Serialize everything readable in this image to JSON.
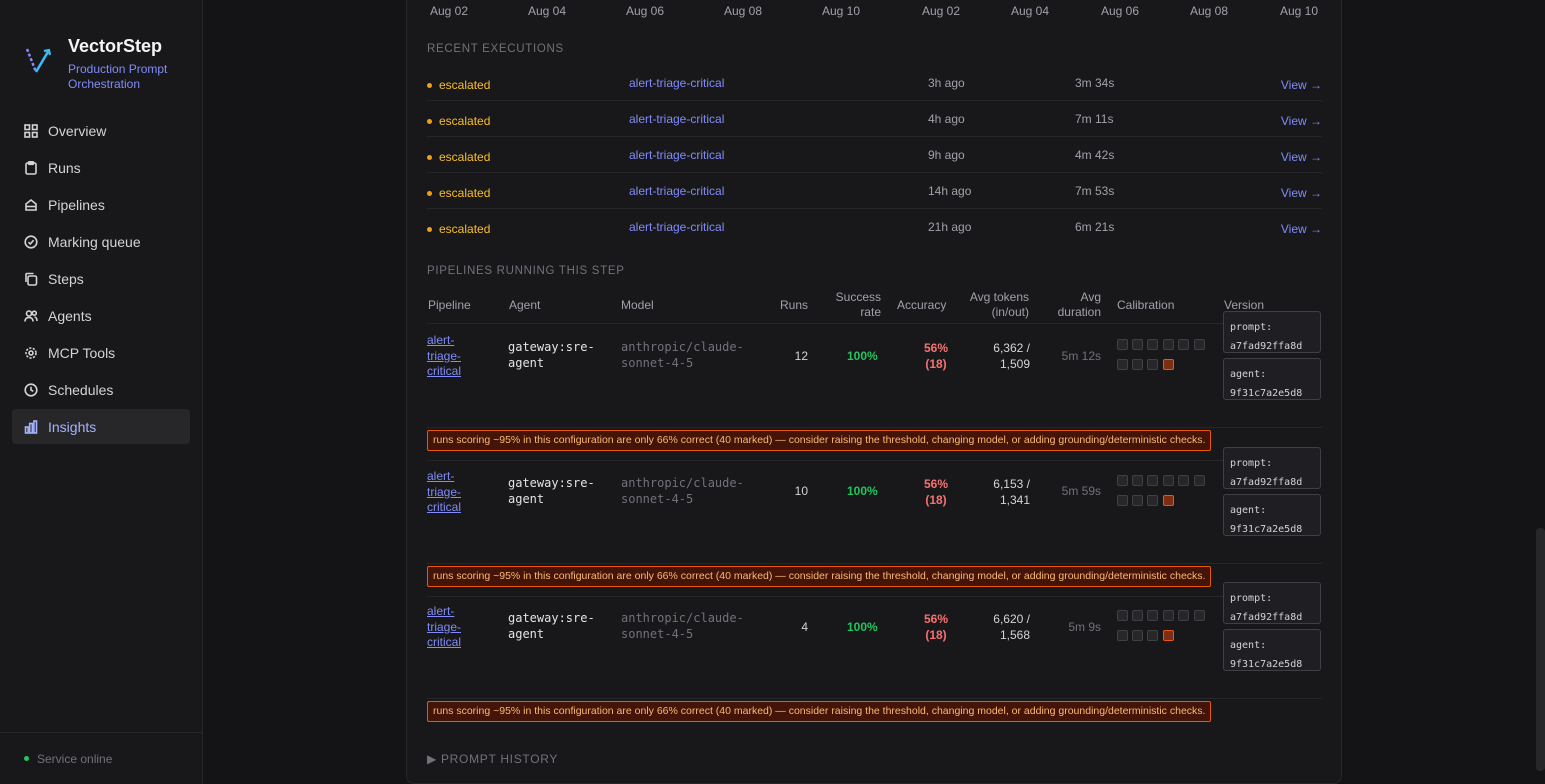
{
  "brand": {
    "name": "VectorStep",
    "subtitle": "Production Prompt Orchestration"
  },
  "nav": [
    {
      "label": "Overview",
      "icon": "grid-icon"
    },
    {
      "label": "Runs",
      "icon": "clipboard-icon"
    },
    {
      "label": "Pipelines",
      "icon": "layers-icon"
    },
    {
      "label": "Marking queue",
      "icon": "check-circle-icon"
    },
    {
      "label": "Steps",
      "icon": "copy-icon"
    },
    {
      "label": "Agents",
      "icon": "users-icon"
    },
    {
      "label": "MCP Tools",
      "icon": "gear-icon"
    },
    {
      "label": "Schedules",
      "icon": "clock-icon"
    },
    {
      "label": "Insights",
      "icon": "bar-chart-icon",
      "active": true
    }
  ],
  "footer": {
    "status": "Service online",
    "status_color": "#22c55e"
  },
  "axis_ticks": [
    "Aug 02",
    "Aug 04",
    "Aug 06",
    "Aug 08",
    "Aug 10",
    "Aug 02",
    "Aug 04",
    "Aug 06",
    "Aug 08",
    "Aug 10"
  ],
  "recent": {
    "title": "RECENT EXECUTIONS",
    "rows": [
      {
        "status": "escalated",
        "pipeline": "alert-triage-critical",
        "ago": "3h ago",
        "duration": "3m 34s",
        "action": "View →"
      },
      {
        "status": "escalated",
        "pipeline": "alert-triage-critical",
        "ago": "4h ago",
        "duration": "7m 11s",
        "action": "View →"
      },
      {
        "status": "escalated",
        "pipeline": "alert-triage-critical",
        "ago": "9h ago",
        "duration": "4m 42s",
        "action": "View →"
      },
      {
        "status": "escalated",
        "pipeline": "alert-triage-critical",
        "ago": "14h ago",
        "duration": "7m 53s",
        "action": "View →"
      },
      {
        "status": "escalated",
        "pipeline": "alert-triage-critical",
        "ago": "21h ago",
        "duration": "6m 21s",
        "action": "View →"
      }
    ]
  },
  "pipelines": {
    "title": "PIPELINES RUNNING THIS STEP",
    "headers": {
      "pipeline": "Pipeline",
      "agent": "Agent",
      "model": "Model",
      "runs": "Runs",
      "success1": "Success",
      "success2": "rate",
      "accuracy": "Accuracy",
      "tokens1": "Avg tokens",
      "tokens2": "(in/out)",
      "duration1": "Avg",
      "duration2": "duration",
      "calibration": "Calibration",
      "version": "Version"
    },
    "rows": [
      {
        "pipeline": "alert-triage-critical",
        "agent": "gateway:sre-agent",
        "model": "anthropic/claude-sonnet-4-5",
        "runs": "12",
        "success": "100%",
        "accuracy": "56% (18)",
        "tokens": "6,362 / 1,509",
        "duration": "5m 12s",
        "calibration_hot": 10,
        "version_prompt": "prompt:\na7fad92ffa8d",
        "version_agent": "agent:\n9f31c7a2e5d8",
        "warning": "runs scoring ~95% in this configuration are only 66% correct (40 marked) — consider raising the threshold, changing model, or adding grounding/deterministic checks."
      },
      {
        "pipeline": "alert-triage-critical",
        "agent": "gateway:sre-agent",
        "model": "anthropic/claude-sonnet-4-5",
        "runs": "10",
        "success": "100%",
        "accuracy": "56% (18)",
        "tokens": "6,153 / 1,341",
        "duration": "5m 59s",
        "calibration_hot": 10,
        "version_prompt": "prompt:\na7fad92ffa8d",
        "version_agent": "agent:\n9f31c7a2e5d8",
        "warning": "runs scoring ~95% in this configuration are only 66% correct (40 marked) — consider raising the threshold, changing model, or adding grounding/deterministic checks."
      },
      {
        "pipeline": "alert-triage-critical",
        "agent": "gateway:sre-agent",
        "model": "anthropic/claude-sonnet-4-5",
        "runs": "4",
        "success": "100%",
        "accuracy": "56% (18)",
        "tokens": "6,620 / 1,568",
        "duration": "5m 9s",
        "calibration_hot": 10,
        "version_prompt": "prompt:\na7fad92ffa8d",
        "version_agent": "agent:\n9f31c7a2e5d8",
        "warning": "runs scoring ~95% in this configuration are only 66% correct (40 marked) — consider raising the threshold, changing model, or adding grounding/deterministic checks."
      }
    ]
  },
  "prompt_history": "▶ PROMPT HISTORY",
  "colors": {
    "accent": "#818cf8",
    "escalated": "#fbbf24",
    "success": "#22c55e",
    "accuracy": "#f87171",
    "warning_bg": "#431407"
  }
}
